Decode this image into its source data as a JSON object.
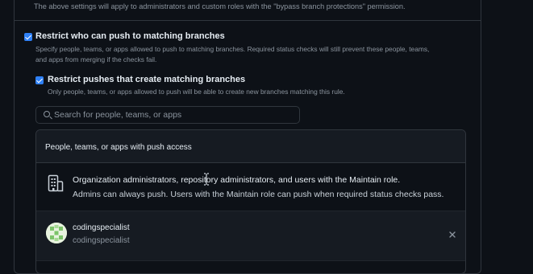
{
  "settings_note": "The above settings will apply to administrators and custom roles with the \"bypass branch protections\" permission.",
  "restrict_push": {
    "label": "Restrict who can push to matching branches",
    "checked": true,
    "description_lines": [
      "Specify people, teams, or apps allowed to push to matching branches. Required status checks will still prevent these people, teams,",
      "and apps from merging if the checks fail."
    ]
  },
  "restrict_create": {
    "label": "Restrict pushes that create matching branches",
    "checked": true,
    "description": "Only people, teams, or apps allowed to push will be able to create new branches matching this rule."
  },
  "search": {
    "placeholder": "Search for people, teams, or apps",
    "value": ""
  },
  "push_access": {
    "header": "People, teams, or apps with push access",
    "org_entry": {
      "icon": "organization-icon",
      "title": "Organization administrators, repository administrators, and users with the Maintain role.",
      "subtitle": "Admins can always push. Users with the Maintain role can push when required status checks pass."
    },
    "users": [
      {
        "name": "codingspecialist",
        "login": "codingspecialist",
        "avatar_icon": "identicon-avatar",
        "remove_icon": "close-icon"
      }
    ]
  },
  "colors": {
    "background": "#0d1117",
    "panel_header": "#161b22",
    "border": "#30363d",
    "checkbox": "#2f81f7",
    "muted_text": "#8b949e"
  }
}
